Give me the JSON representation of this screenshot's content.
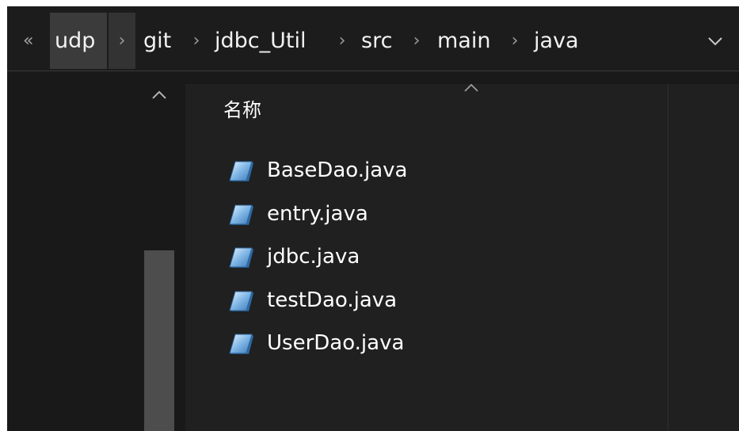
{
  "breadcrumb": {
    "overflow_glyph": "«",
    "items": [
      {
        "label": "udp"
      },
      {
        "label": "git"
      },
      {
        "label": "jdbc_Util"
      },
      {
        "label": "src"
      },
      {
        "label": "main"
      },
      {
        "label": "java"
      }
    ],
    "separator": "›"
  },
  "file_list": {
    "column_header": "名称",
    "files": [
      {
        "name": "BaseDao.java",
        "icon": "java-file-icon"
      },
      {
        "name": "entry.java",
        "icon": "java-file-icon"
      },
      {
        "name": "jdbc.java",
        "icon": "java-file-icon"
      },
      {
        "name": "testDao.java",
        "icon": "java-file-icon"
      },
      {
        "name": "UserDao.java",
        "icon": "java-file-icon"
      }
    ]
  },
  "colors": {
    "background": "#191919",
    "content_background": "#202020",
    "text": "#ffffff",
    "active_crumb": "#3b3b3b"
  }
}
